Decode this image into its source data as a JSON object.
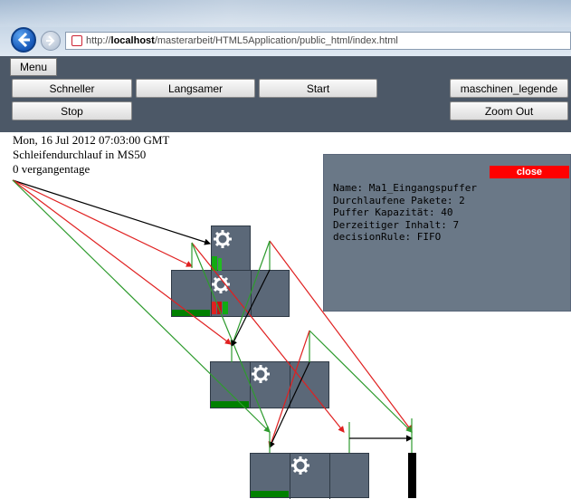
{
  "browser": {
    "url_prefix": "http://",
    "url_host": "localhost",
    "url_path": "/masterarbeit/HTML5Application/public_html/index.html"
  },
  "toolbar": {
    "menu_label": "Menu",
    "faster_label": "Schneller",
    "slower_label": "Langsamer",
    "start_label": "Start",
    "legend_label": "maschinen_legende",
    "stop_label": "Stop",
    "zoom_out_label": "Zoom Out"
  },
  "status": {
    "date": "Mon, 16 Jul 2012 07:03:00 GMT",
    "loop": "Schleifendurchlauf in MS50",
    "days": "0 vergangentage"
  },
  "popup": {
    "close_label": "close",
    "name": "Name: Ma1_Eingangspuffer",
    "packets": "Durchlaufene Pakete: 2",
    "capacity": "Puffer Kapazität: 40",
    "content": "Derzeitiger Inhalt: 7",
    "rule": "decisionRule: FIFO"
  },
  "colors": {
    "toolbar_bg": "#4c5867",
    "machine_bg": "#5b6878",
    "popup_bg": "#6a7887",
    "close_bg": "#ff0000",
    "buffer_fill": "#008000",
    "flow_green": "#2e9b2e",
    "flow_red": "#e02020",
    "flow_black": "#000000"
  },
  "icons": {
    "back": "back-arrow-icon",
    "forward": "forward-arrow-icon",
    "favicon": "page-favicon-icon",
    "machine": "gear-icon",
    "worker": "worker-figure-icon"
  }
}
